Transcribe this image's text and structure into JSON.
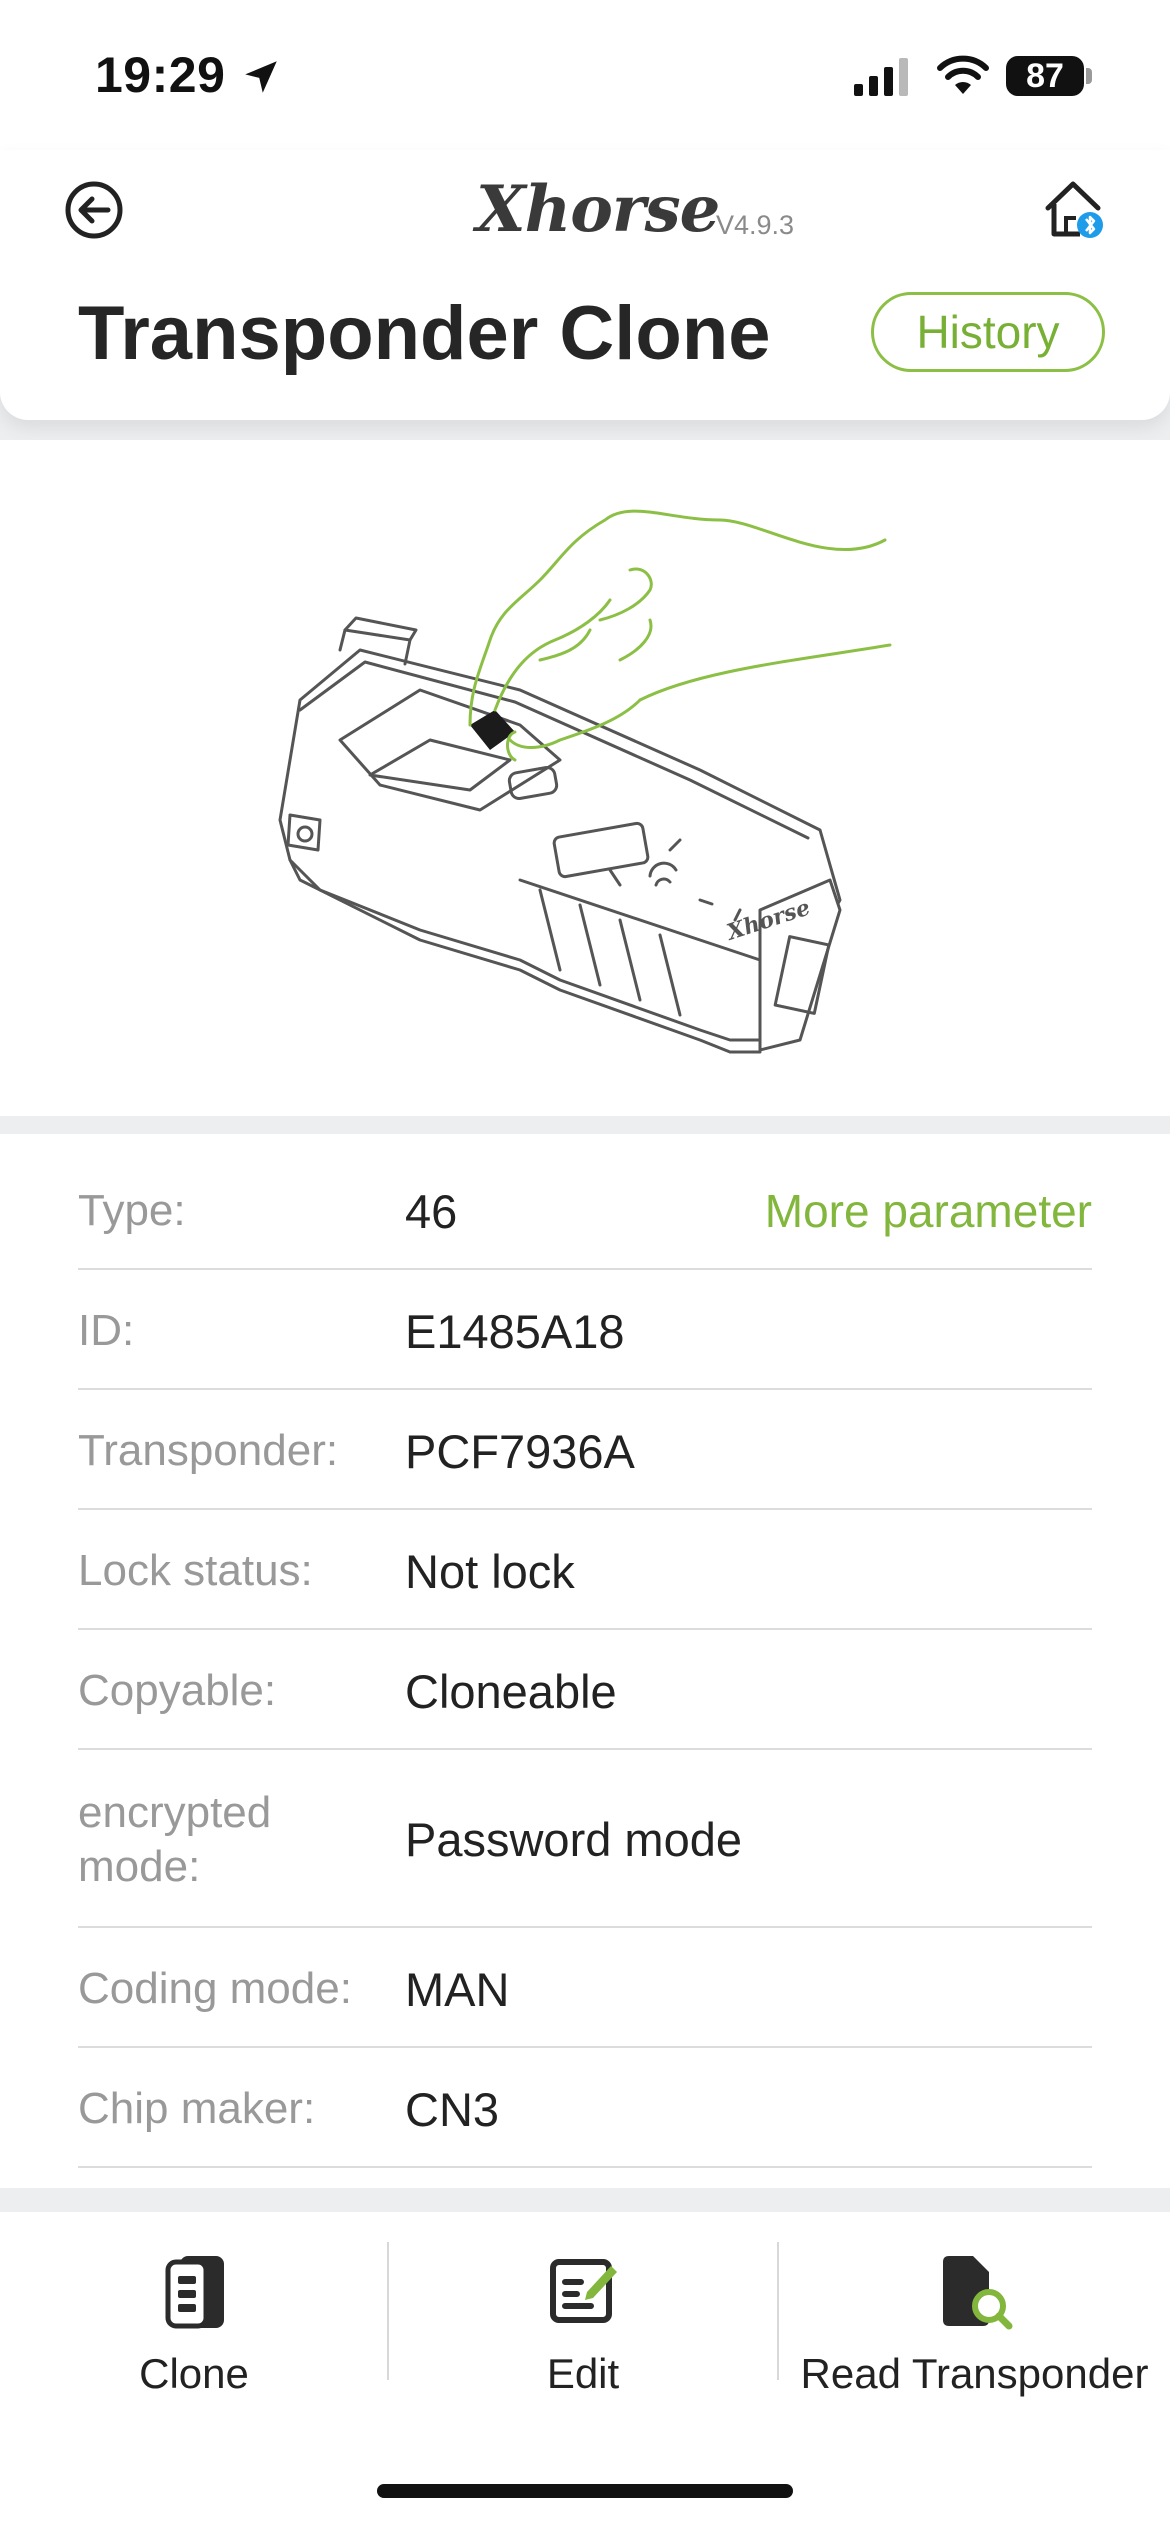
{
  "status_bar": {
    "time": "19:29",
    "battery": "87"
  },
  "header": {
    "logo": "Xhorse",
    "version": "V4.9.3",
    "title": "Transponder Clone",
    "history_label": "History"
  },
  "info": {
    "more_parameter_label": "More parameter",
    "rows": [
      {
        "label": "Type:",
        "value": "46"
      },
      {
        "label": "ID:",
        "value": "E1485A18"
      },
      {
        "label": "Transponder:",
        "value": "PCF7936A"
      },
      {
        "label": "Lock status:",
        "value": "Not lock"
      },
      {
        "label": "Copyable:",
        "value": "Cloneable"
      },
      {
        "label": "encrypted mode:",
        "value": "Password mode"
      },
      {
        "label": "Coding mode:",
        "value": "MAN"
      },
      {
        "label": "Chip maker:",
        "value": "CN3"
      }
    ]
  },
  "device_logo": "Xhorse",
  "tabs": [
    {
      "label": "Clone",
      "icon": "key-fob-icon"
    },
    {
      "label": "Edit",
      "icon": "edit-icon"
    },
    {
      "label": "Read Transponder",
      "icon": "read-transponder-icon"
    }
  ],
  "colors": {
    "accent": "#82b63d",
    "background": "#eceef0"
  }
}
